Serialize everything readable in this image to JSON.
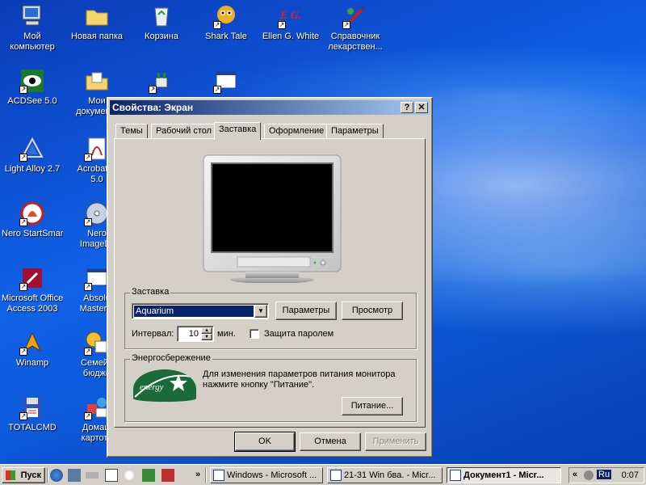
{
  "desktop": {
    "icons": [
      {
        "label1": "Мой",
        "label2": "компьютер"
      },
      {
        "label1": "Новая папка",
        "label2": ""
      },
      {
        "label1": "Корзина",
        "label2": ""
      },
      {
        "label1": "Shark Tale",
        "label2": ""
      },
      {
        "label1": "Ellen G. White",
        "label2": ""
      },
      {
        "label1": "Справочник",
        "label2": "лекарствен..."
      },
      {
        "label1": "ACDSee 5.0",
        "label2": ""
      },
      {
        "label1": "Мои",
        "label2": "докумен..."
      },
      {
        "label1": "Light Alloy 2.7",
        "label2": ""
      },
      {
        "label1": "Acrobat R",
        "label2": "5.0"
      },
      {
        "label1": "Nero StartSmart",
        "label2": ""
      },
      {
        "label1": "Nero",
        "label2": "ImageDr"
      },
      {
        "label1": "Microsoft Office",
        "label2": "Access 2003"
      },
      {
        "label1": "Absolu",
        "label2": "Masterm"
      },
      {
        "label1": "Winamp",
        "label2": ""
      },
      {
        "label1": "Семейн",
        "label2": "бюдже"
      },
      {
        "label1": "TOTALCMD",
        "label2": ""
      },
      {
        "label1": "Домаш",
        "label2": "картоте"
      }
    ],
    "logo_text": "E G."
  },
  "dialog": {
    "title": "Свойства: Экран",
    "help_glyph": "?",
    "close_glyph": "✕",
    "tabs": [
      "Темы",
      "Рабочий стол",
      "Заставка",
      "Оформление",
      "Параметры"
    ],
    "active_tab": "Заставка",
    "screensaver": {
      "group_label": "Заставка",
      "selected": "Aquarium",
      "params_button": "Параметры",
      "preview_button": "Просмотр",
      "interval_label": "Интервал:",
      "interval_value": "10",
      "interval_unit": "мин.",
      "password_label": "Защита паролем",
      "password_checked": false
    },
    "power": {
      "group_label": "Энергосбережение",
      "description": "Для изменения параметров питания монитора нажмите кнопку \"Питание\".",
      "power_button": "Питание...",
      "logo_text": "energy"
    },
    "ok_button": "OK",
    "cancel_button": "Отмена",
    "apply_button": "Применить"
  },
  "taskbar": {
    "start_label": "Пуск",
    "tasks": [
      {
        "label": "Windows - Microsoft ...",
        "active": false
      },
      {
        "label": "21-31 Win бва. - Micr...",
        "active": false
      },
      {
        "label": "Документ1 - Micr...",
        "active": true
      }
    ],
    "chevron": "«",
    "lang": "Ru",
    "clock": "0:07"
  },
  "colors": {
    "titlebar_start": "#0a246a",
    "titlebar_end": "#a6caf0",
    "face": "#d4d0c8",
    "selection": "#0a246a"
  }
}
